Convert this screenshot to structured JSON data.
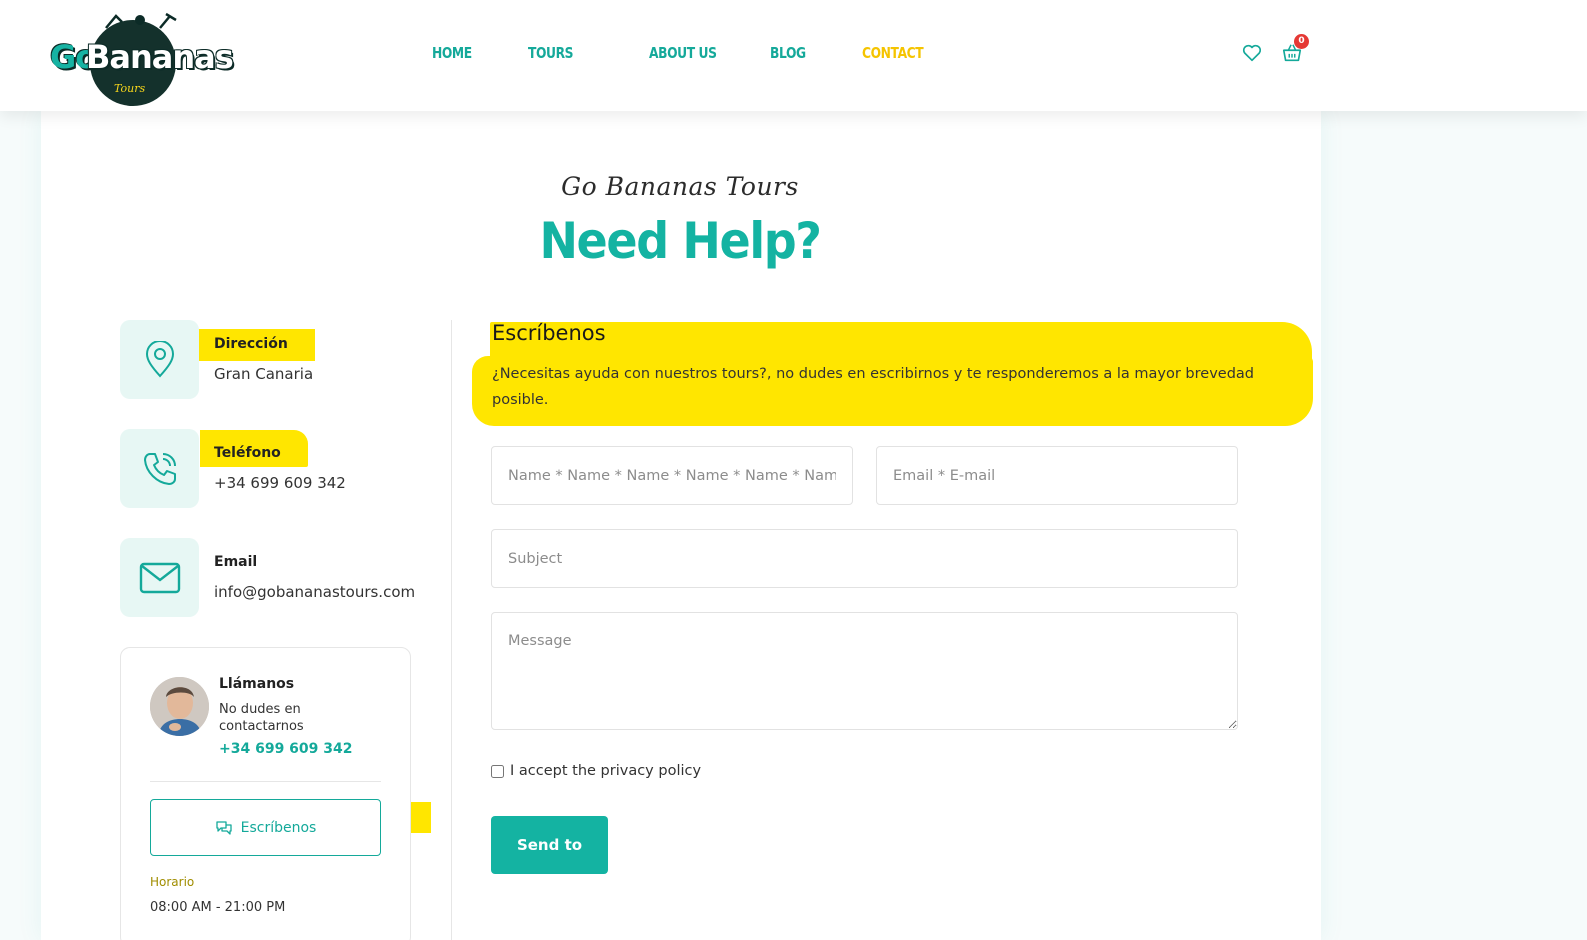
{
  "colors": {
    "brand_teal": "#14b3a2",
    "accent_yellow": "#f5c400",
    "highlight": "#ffe600",
    "badge_red": "#e53935"
  },
  "header": {
    "logo": {
      "text_go": "Go",
      "text_bananas": "Bananas",
      "text_tours": "Tours"
    },
    "nav": [
      {
        "label": "HOME"
      },
      {
        "label": "TOURS"
      },
      {
        "label": "ABOUT US"
      },
      {
        "label": "BLOG"
      },
      {
        "label": "CONTACT",
        "active": true
      }
    ],
    "icons": {
      "wishlist": "heart-icon",
      "cart": "basket-icon"
    },
    "cart_count": "0"
  },
  "hero": {
    "script_subtitle": "Go Bananas Tours",
    "title": "Need Help?"
  },
  "contact_info": [
    {
      "label": "Dirección",
      "value": "Gran Canaria",
      "icon": "map-pin-icon"
    },
    {
      "label": "Teléfono",
      "value": "+34 699 609 342",
      "icon": "phone-icon"
    },
    {
      "label": "Email",
      "value": "info@gobananastours.com",
      "icon": "mail-icon"
    }
  ],
  "call_box": {
    "title": "Llámanos",
    "text": "No dudes en contactarnos",
    "phone": "+34 699 609 342",
    "button_label": "Escríbenos",
    "button_icon": "chat-icon",
    "hours_label": "Horario",
    "hours_value": "08:00 AM - 21:00 PM"
  },
  "form": {
    "title": "Escríbenos",
    "description": "¿Necesitas ayuda con nuestros tours?, no dudes en escribirnos y te responderemos a la mayor brevedad posible.",
    "name_placeholder": "Name * Name * Name * Name * Name * Name",
    "email_placeholder": "Email * E-mail",
    "subject_placeholder": "Subject",
    "message_placeholder": "Message",
    "privacy_label": "I accept the privacy policy",
    "submit_label": "Send to"
  }
}
